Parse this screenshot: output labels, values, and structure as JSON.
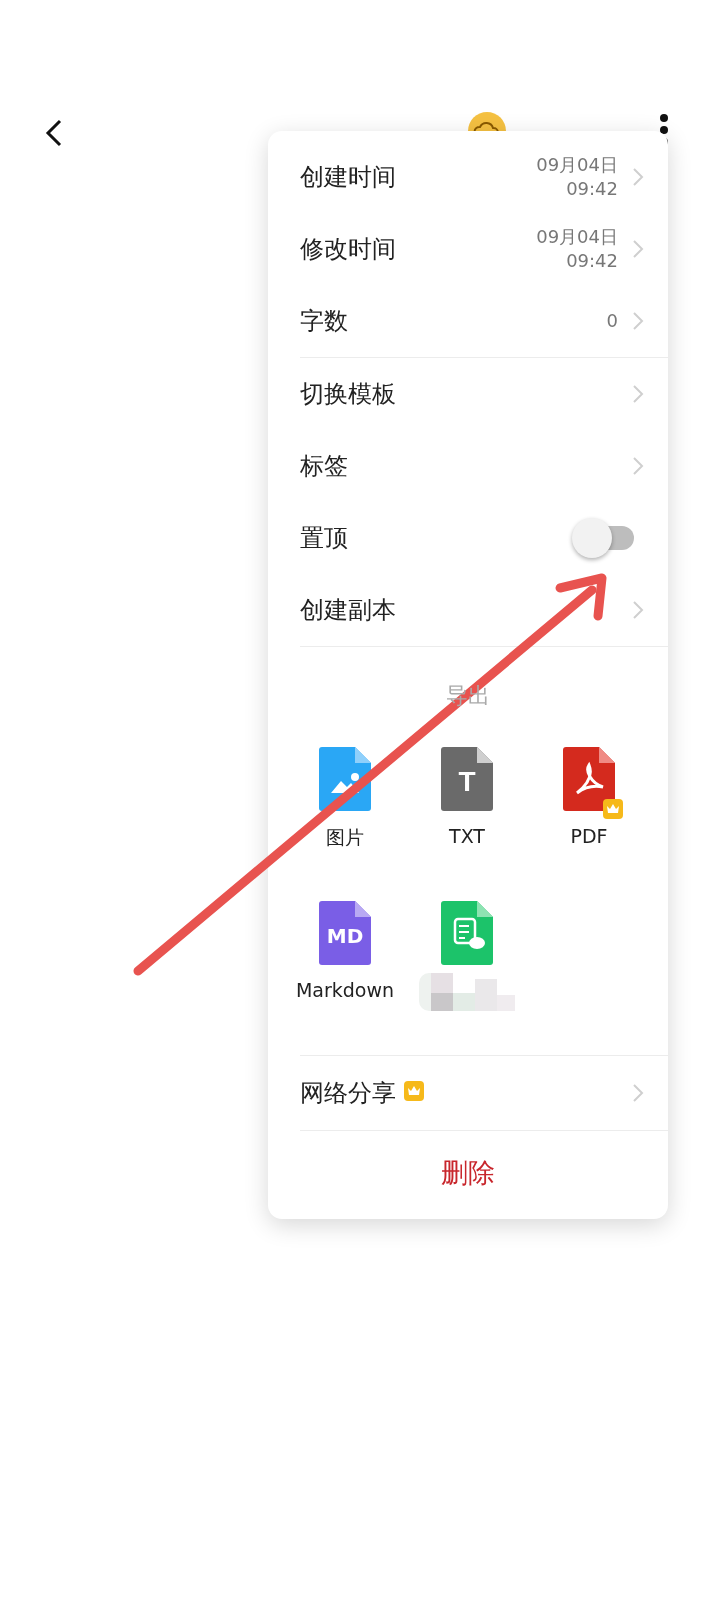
{
  "menu": {
    "sections": [
      {
        "items": [
          {
            "kind": "value",
            "label": "创建时间",
            "value_lines": [
              "09月04日",
              "09:42"
            ]
          },
          {
            "kind": "value",
            "label": "修改时间",
            "value_lines": [
              "09月04日",
              "09:42"
            ]
          },
          {
            "kind": "value",
            "label": "字数",
            "value_lines": [
              "0"
            ]
          }
        ]
      },
      {
        "items": [
          {
            "kind": "link",
            "label": "切换模板"
          },
          {
            "kind": "link",
            "label": "标签"
          },
          {
            "kind": "toggle",
            "label": "置顶",
            "on": false
          },
          {
            "kind": "link",
            "label": "创建副本"
          }
        ]
      }
    ],
    "export": {
      "title": "导出",
      "formats": [
        {
          "kind": "image",
          "label": "图片",
          "premium": false
        },
        {
          "kind": "txt",
          "label": "TXT",
          "icon_text": "T",
          "premium": false
        },
        {
          "kind": "pdf",
          "label": "PDF",
          "premium": true
        },
        {
          "kind": "markdown",
          "label": "Markdown",
          "icon_text": "MD",
          "premium": false
        },
        {
          "kind": "wechat",
          "label_obscured": true,
          "premium": false
        }
      ]
    },
    "share": {
      "label": "网络分享",
      "premium": true
    },
    "delete": {
      "label": "删除"
    }
  }
}
